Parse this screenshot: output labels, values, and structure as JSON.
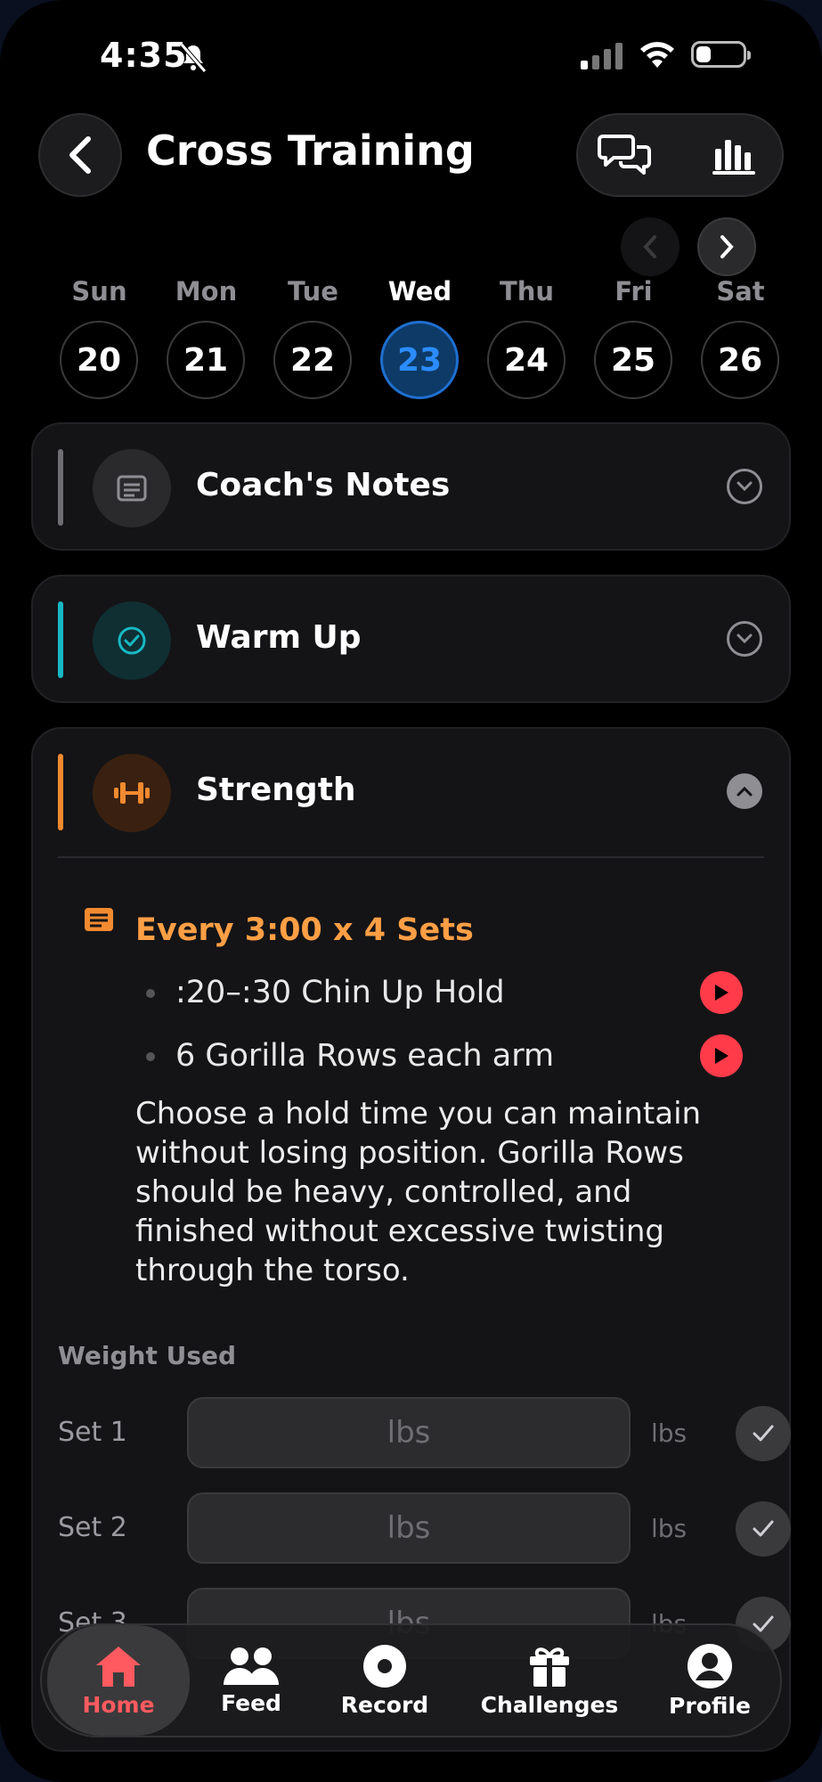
{
  "status": {
    "time": "4:35"
  },
  "header": {
    "title": "Cross Training"
  },
  "week": {
    "days": [
      {
        "name": "Sun",
        "date": "20"
      },
      {
        "name": "Mon",
        "date": "21"
      },
      {
        "name": "Tue",
        "date": "22"
      },
      {
        "name": "Wed",
        "date": "23",
        "selected": true
      },
      {
        "name": "Thu",
        "date": "24"
      },
      {
        "name": "Fri",
        "date": "25"
      },
      {
        "name": "Sat",
        "date": "26"
      }
    ]
  },
  "sections": {
    "coach_notes": {
      "title": "Coach's Notes",
      "color": "#6e6e73"
    },
    "warm_up": {
      "title": "Warm Up",
      "color": "#18b8c4"
    },
    "strength": {
      "title": "Strength",
      "color": "#f28a30",
      "block_title": "Every 3:00 x 4 Sets",
      "movements": [
        ":20–:30 Chin Up Hold",
        "6 Gorilla Rows each arm"
      ],
      "description": "Choose a hold time you can maintain without losing position. Gorilla Rows should be heavy, controlled, and finished without excessive twisting through the torso.",
      "weight_label": "Weight Used",
      "sets": [
        {
          "label": "Set 1",
          "placeholder": "lbs",
          "unit": "lbs"
        },
        {
          "label": "Set 2",
          "placeholder": "lbs",
          "unit": "lbs"
        },
        {
          "label": "Set 3",
          "placeholder": "lbs",
          "unit": "lbs"
        }
      ]
    }
  },
  "nav": {
    "items": [
      {
        "label": "Home",
        "icon": "home-icon",
        "active": true
      },
      {
        "label": "Feed",
        "icon": "people-icon"
      },
      {
        "label": "Record",
        "icon": "record-icon"
      },
      {
        "label": "Challenges",
        "icon": "gift-icon"
      },
      {
        "label": "Profile",
        "icon": "profile-icon"
      }
    ]
  },
  "colors": {
    "accent_blue": "#2b8cff",
    "play_red": "#ff3b4a",
    "home_red": "#ff5a5f"
  }
}
